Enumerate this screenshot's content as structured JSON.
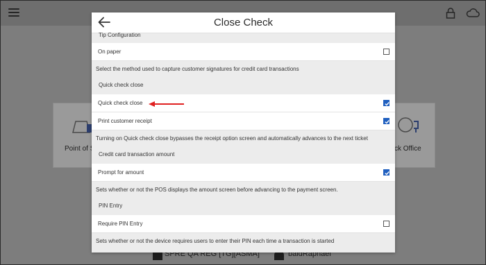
{
  "modal": {
    "title": "Close Check",
    "sections": {
      "tip": {
        "header": "Tip Configuration",
        "on_paper_label": "On paper",
        "on_paper_checked": false,
        "description": "Select the method used to capture customer signatures for credit card transactions"
      },
      "quick": {
        "header": "Quick check close",
        "quick_check_close_label": "Quick check close",
        "quick_check_close_checked": true,
        "print_receipt_label": "Print customer receipt",
        "print_receipt_checked": true,
        "description": "Turning on Quick check close bypasses the receipt option screen and automatically advances to the next ticket"
      },
      "credit": {
        "header": "Credit card transaction amount",
        "prompt_label": "Prompt for amount",
        "prompt_checked": true,
        "description": "Sets whether or not the POS displays the amount screen before advancing to the payment screen."
      },
      "pin": {
        "header": "PIN Entry",
        "require_label": "Require PIN Entry",
        "require_checked": false,
        "description": "Sets whether or not the device requires users to enter their PIN each time a transaction is started"
      }
    }
  },
  "background": {
    "tile_left_label": "Point of S",
    "tile_right_label": "ck Office",
    "bottom_store": "SPRE QA REG [TG][ASMA]",
    "bottom_user": "baldRaphael"
  },
  "colors": {
    "accent": "#1f5fbf",
    "annotation_arrow": "#e02020"
  }
}
